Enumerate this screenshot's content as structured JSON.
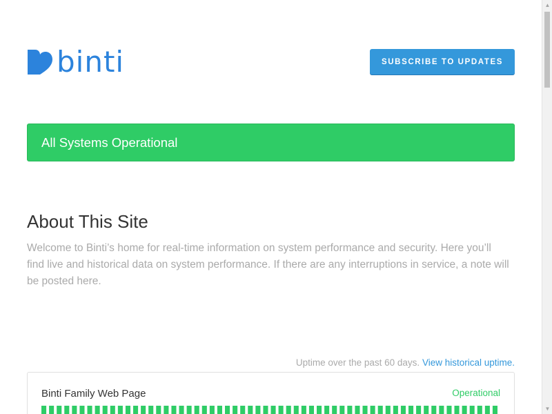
{
  "header": {
    "logo_text": "binti",
    "subscribe_label": "SUBSCRIBE TO UPDATES"
  },
  "status": {
    "message": "All Systems Operational",
    "color": "#2fcc66"
  },
  "about": {
    "title": "About This Site",
    "body": "Welcome to Binti’s home for real-time information on system performance and security. Here you’ll find live and historical data on system performance. If there are any interruptions in service, a note will be posted here."
  },
  "uptime": {
    "caption": "Uptime over the past 60 days.",
    "link_label": "View historical uptime.",
    "components": [
      {
        "name": "Binti Family Web Page",
        "status": "Operational",
        "days": 60,
        "bar_color": "#2fcc66"
      }
    ]
  },
  "colors": {
    "brand": "#2c83dc",
    "accent": "#3498db",
    "operational": "#2fcc66"
  },
  "icons": {
    "logo": "heart-logo-icon",
    "scroll_up": "scroll-up-arrow-icon",
    "scroll_down": "scroll-down-arrow-icon"
  }
}
